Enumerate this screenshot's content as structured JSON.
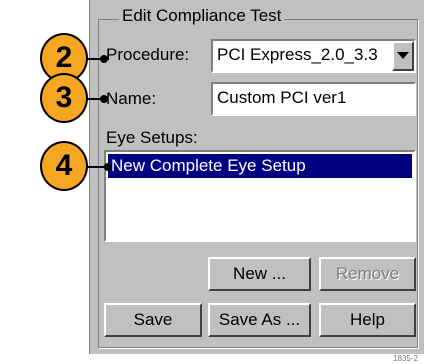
{
  "dialog": {
    "title": "Edit Compliance Test",
    "procedure_label": "Procedure:",
    "procedure_value": "PCI Express_2.0_3.3",
    "name_label": "Name:",
    "name_value": "Custom PCI ver1",
    "eye_setups_label": "Eye Setups:",
    "eye_setups": [
      "New Complete Eye Setup"
    ]
  },
  "buttons": {
    "new": "New ...",
    "remove": "Remove",
    "save": "Save",
    "save_as": "Save As ...",
    "help": "Help"
  },
  "callouts": [
    "2",
    "3",
    "4"
  ],
  "figure_number": "1835-2",
  "colors": {
    "callout": "#f5a623",
    "selection": "#000080",
    "panel": "#c0c0c0"
  }
}
